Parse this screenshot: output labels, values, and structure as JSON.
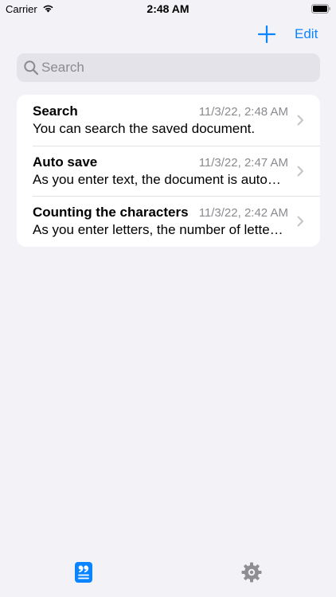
{
  "status_bar": {
    "carrier": "Carrier",
    "time": "2:48 AM"
  },
  "nav": {
    "edit_label": "Edit",
    "add_icon": "plus-icon"
  },
  "search": {
    "placeholder": "Search",
    "value": ""
  },
  "documents": [
    {
      "title": "Search",
      "date": "11/3/22, 2:48 AM",
      "preview": "You can search the saved document."
    },
    {
      "title": "Auto save",
      "date": "11/3/22, 2:47 AM",
      "preview": "As you enter text, the document is auto…"
    },
    {
      "title": "Counting the characters",
      "date": "11/3/22, 2:42 AM",
      "preview": "As you enter letters, the number of lette…"
    }
  ],
  "tab_bar": {
    "documents_icon": "document-quote-icon",
    "settings_icon": "gear-icon"
  },
  "colors": {
    "accent": "#0A84FF",
    "background": "#F2F2F7",
    "secondary_text": "#8A8A8F",
    "inactive_icon": "#8E8E93"
  }
}
